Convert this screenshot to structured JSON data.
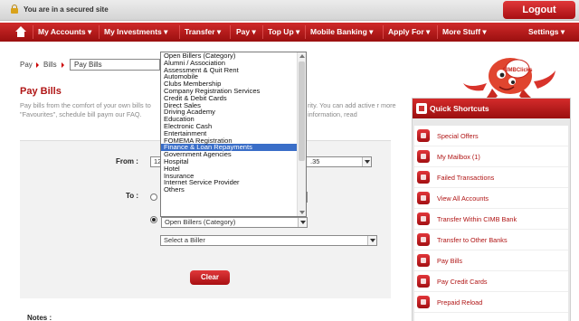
{
  "topbar": {
    "secure_text": "You are in a secured site",
    "logout": "Logout"
  },
  "nav": {
    "items": [
      "My Accounts ▾",
      "My Investments ▾",
      "Transfer ▾",
      "Pay ▾",
      "Top Up ▾",
      "Mobile Banking ▾",
      "Apply For ▾",
      "More Stuff ▾",
      "Settings ▾"
    ]
  },
  "breadcrumb": {
    "items": [
      "Pay",
      "Bills"
    ],
    "current": "Pay Bills"
  },
  "page": {
    "title": "Pay Bills",
    "intro_left": "Pay bills from the comfort of your own bills to \"Favourites\", schedule bill paym our FAQ.",
    "intro_right": "rity. You can add active r more information, read"
  },
  "form": {
    "from_label": "From :",
    "from_value_left": "12",
    "from_value_right": ".35",
    "to_label": "To :",
    "category_select": "Open Billers (Category)",
    "biller_select": "Select a Biller",
    "clear_button": "Clear",
    "notes_label": "Notes :"
  },
  "dropdown": {
    "items": [
      "Open Billers (Category)",
      "Alumni / Association",
      "Assessment & Quit Rent",
      "Automobile",
      "Clubs Membership",
      "Company Registration Services",
      "Credit & Debit Cards",
      "Direct Sales",
      "Driving Academy",
      "Education",
      "Electronic Cash",
      "Entertainment",
      "FOMEMA Registration",
      "Finance & Loan Repayments",
      "Government Agencies",
      "Hospital",
      "Hotel",
      "Insurance",
      "Internet Service Provider",
      "Others"
    ],
    "highlighted": "Finance & Loan Repayments"
  },
  "mascot": {
    "badge_text": "CIMBClicks"
  },
  "shortcuts": {
    "title": "Quick Shortcuts",
    "items": [
      "Special Offers",
      "My Mailbox  (1)",
      "Failed Transactions",
      "View All Accounts",
      "Transfer Within CIMB Bank",
      "Transfer to Other Banks",
      "Pay Bills",
      "Pay Credit Cards",
      "Prepaid Reload"
    ]
  }
}
